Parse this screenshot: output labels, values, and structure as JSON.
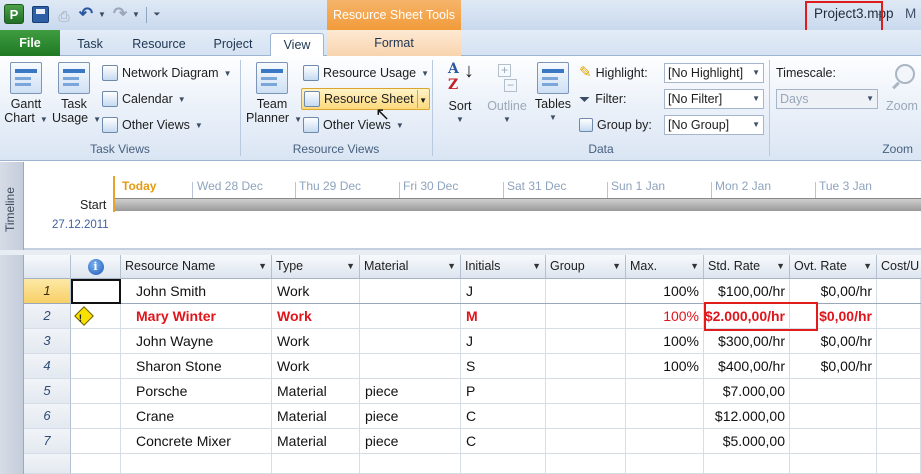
{
  "qat": {
    "app_letter": "P"
  },
  "title": {
    "context_tab_group": "Resource Sheet Tools",
    "file_name": "Project3.mpp",
    "separator": "-",
    "rest": "M"
  },
  "tabs": [
    {
      "label": "File"
    },
    {
      "label": "Task"
    },
    {
      "label": "Resource"
    },
    {
      "label": "Project"
    },
    {
      "label": "View",
      "active": true
    },
    {
      "label": "Format"
    }
  ],
  "ribbon": {
    "task_views": {
      "group_label": "Task Views",
      "gantt_chart": [
        "Gantt",
        "Chart"
      ],
      "task_usage": [
        "Task",
        "Usage"
      ],
      "network_diagram": "Network Diagram",
      "calendar": "Calendar",
      "other_views": "Other Views"
    },
    "resource_views": {
      "group_label": "Resource Views",
      "team_planner": [
        "Team",
        "Planner"
      ],
      "resource_usage": "Resource Usage",
      "resource_sheet": "Resource Sheet",
      "other_views": "Other Views"
    },
    "data": {
      "group_label": "Data",
      "sort": "Sort",
      "outline": "Outline",
      "tables": "Tables",
      "highlight_label": "Highlight:",
      "highlight_value": "[No Highlight]",
      "filter_label": "Filter:",
      "filter_value": "[No Filter]",
      "group_by_label": "Group by:",
      "group_by_value": "[No Group]"
    },
    "zoom": {
      "group_label": "Zoom",
      "timescale_label": "Timescale:",
      "timescale_value": "Days",
      "zoom_button": "Zoom"
    }
  },
  "timeline": {
    "side_label": "Timeline",
    "dates": [
      "Today",
      "Wed 28 Dec",
      "Thu 29 Dec",
      "Fri 30 Dec",
      "Sat 31 Dec",
      "Sun 1 Jan",
      "Mon 2 Jan",
      "Tue 3 Jan"
    ],
    "start_label": "Start",
    "start_date": "27.12.2011"
  },
  "sheet": {
    "columns": [
      "",
      "Resource Name",
      "Type",
      "Material",
      "Initials",
      "Group",
      "Max.",
      "Std. Rate",
      "Ovt. Rate",
      "Cost/U"
    ],
    "rows": [
      {
        "id": "1",
        "name": "John Smith",
        "type": "Work",
        "material": "",
        "initials": "J",
        "max": "100%",
        "std_rate": "$100,00/hr",
        "ovt_rate": "$0,00/hr",
        "indicator": "",
        "overallocated": false
      },
      {
        "id": "2",
        "name": "Mary Winter",
        "type": "Work",
        "material": "",
        "initials": "M",
        "max": "100%",
        "std_rate": "$2.000,00/hr",
        "ovt_rate": "$0,00/hr",
        "indicator": "!",
        "overallocated": true
      },
      {
        "id": "3",
        "name": "John Wayne",
        "type": "Work",
        "material": "",
        "initials": "J",
        "max": "100%",
        "std_rate": "$300,00/hr",
        "ovt_rate": "$0,00/hr",
        "indicator": "",
        "overallocated": false
      },
      {
        "id": "4",
        "name": "Sharon Stone",
        "type": "Work",
        "material": "",
        "initials": "S",
        "max": "100%",
        "std_rate": "$400,00/hr",
        "ovt_rate": "$0,00/hr",
        "indicator": "",
        "overallocated": false
      },
      {
        "id": "5",
        "name": "Porsche",
        "type": "Material",
        "material": "piece",
        "initials": "P",
        "max": "",
        "std_rate": "$7.000,00",
        "ovt_rate": "",
        "indicator": "",
        "overallocated": false
      },
      {
        "id": "6",
        "name": "Crane",
        "type": "Material",
        "material": "piece",
        "initials": "C",
        "max": "",
        "std_rate": "$12.000,00",
        "ovt_rate": "",
        "indicator": "",
        "overallocated": false
      },
      {
        "id": "7",
        "name": "Concrete Mixer",
        "type": "Material",
        "material": "piece",
        "initials": "C",
        "max": "",
        "std_rate": "$5.000,00",
        "ovt_rate": "",
        "indicator": "",
        "overallocated": false
      }
    ]
  },
  "colors": {
    "overallocated_text": "#e0141b",
    "annotation_box": "#e21b1b",
    "file_tab": "#2a8a2e",
    "context_tab": "#f29b3a"
  }
}
